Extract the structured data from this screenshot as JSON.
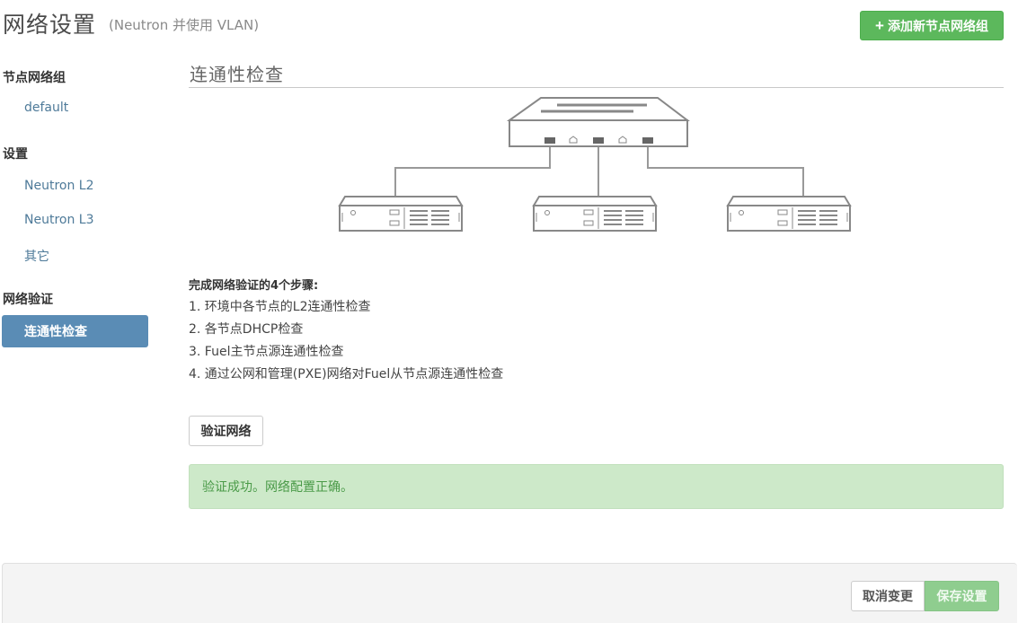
{
  "header": {
    "title": "网络设置",
    "subtitle": "(Neutron 并使用 VLAN)",
    "add_group_label": "添加新节点网络组"
  },
  "sidebar": {
    "node_groups_heading": "节点网络组",
    "node_groups": [
      "default"
    ],
    "settings_heading": "设置",
    "settings_items": [
      "Neutron L2",
      "Neutron L3",
      "其它"
    ],
    "verification_heading": "网络验证",
    "verification_items": [
      "连通性检查"
    ],
    "active_item": "连通性检查"
  },
  "main": {
    "section_title": "连通性检查",
    "steps_title": "完成网络验证的4个步骤:",
    "steps": [
      "1. 环境中各节点的L2连通性检查",
      "2. 各节点DHCP检查",
      "3. Fuel主节点源连通性检查",
      "4. 通过公网和管理(PXE)网络对Fuel从节点源连通性检查"
    ],
    "verify_button_label": "验证网络",
    "success_message": "验证成功。网络配置正确。"
  },
  "footer": {
    "cancel_label": "取消变更",
    "save_label": "保存设置"
  },
  "colors": {
    "primary_green": "#5cb85c",
    "active_blue": "#5a8cb5",
    "link_blue": "#4e7a99",
    "success_bg": "#cde9c9",
    "success_text": "#4a9a48"
  }
}
